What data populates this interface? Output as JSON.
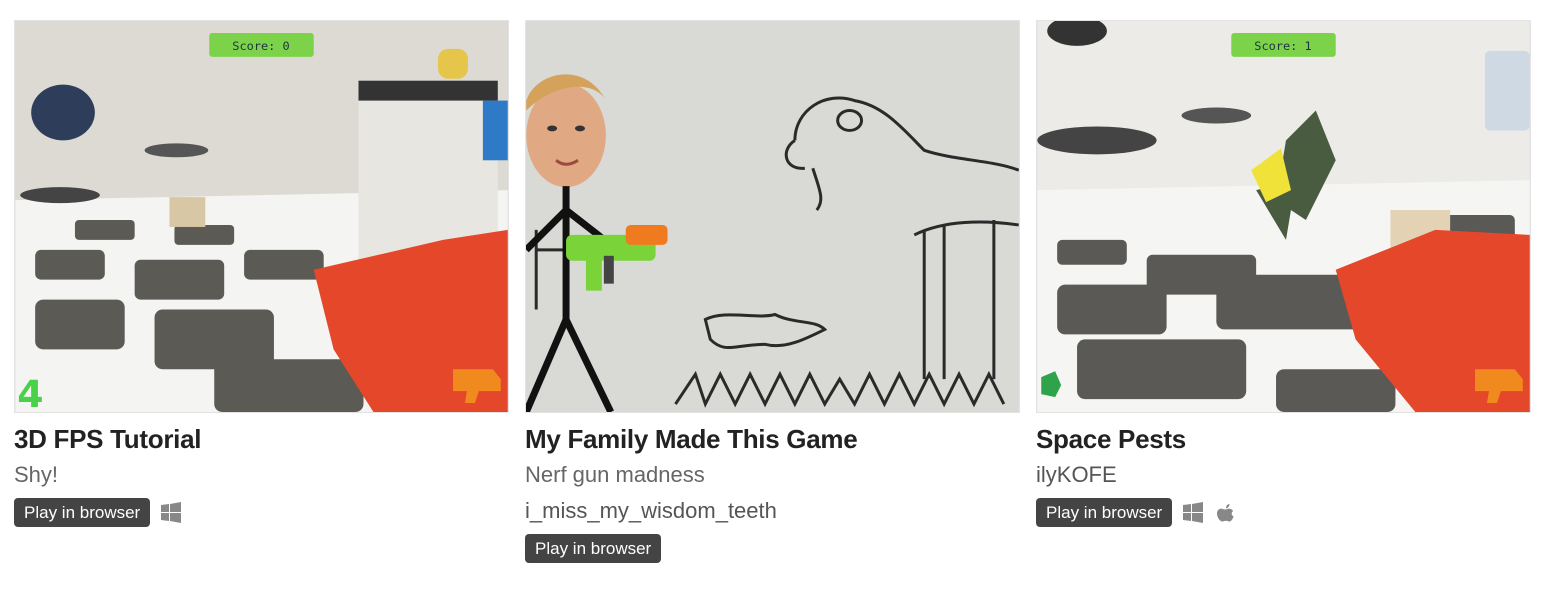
{
  "games": [
    {
      "title": "3D FPS Tutorial",
      "short_text": "Shy!",
      "author": "",
      "web_flag": "Play in browser",
      "platforms": [
        "windows-icon"
      ],
      "hud_score": "Score: 0",
      "hud_ammo": "4"
    },
    {
      "title": "My Family Made This Game",
      "short_text": "Nerf gun madness",
      "author": "i_miss_my_wisdom_teeth",
      "web_flag": "Play in browser",
      "platforms": []
    },
    {
      "title": "Space Pests",
      "short_text": "",
      "author": "ilyKOFE",
      "web_flag": "Play in browser",
      "platforms": [
        "windows-icon",
        "apple-icon"
      ],
      "hud_score": "Score: 1"
    }
  ],
  "colors": {
    "title": "#222222",
    "meta": "#666666",
    "web_flag_bg": "#444444",
    "platform_icon": "#888888",
    "hud_green": "#7cd34a"
  }
}
